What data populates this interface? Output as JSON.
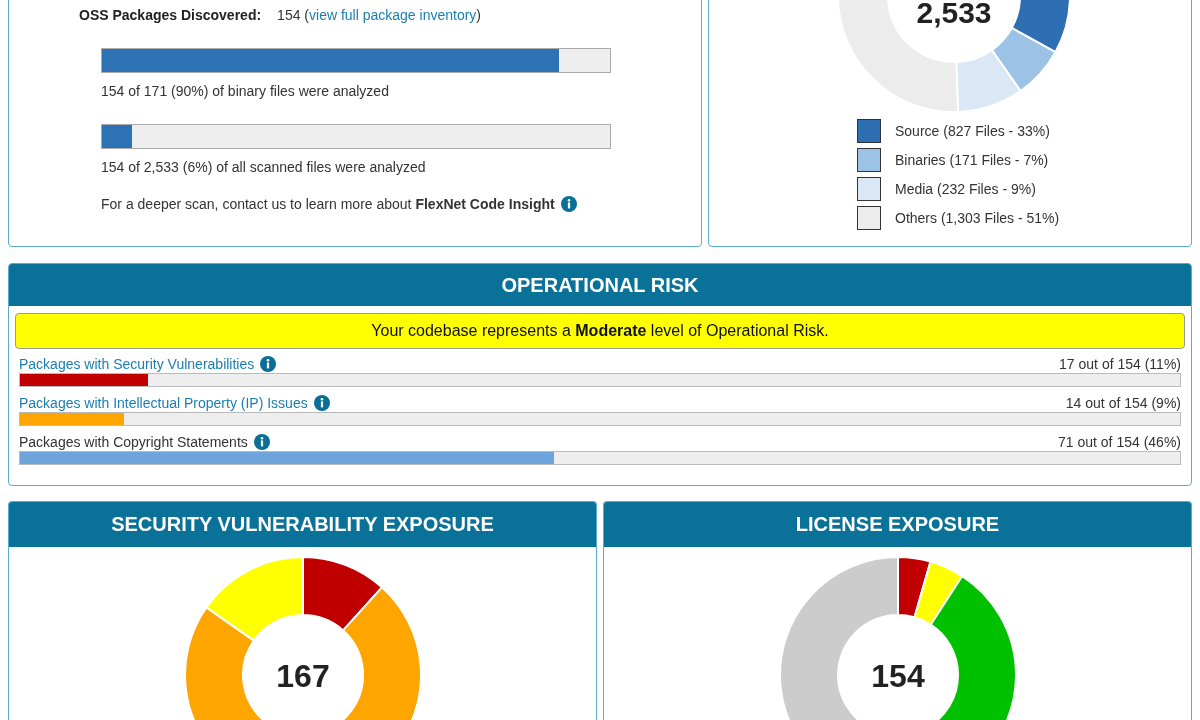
{
  "inventory": {
    "label": "OSS Packages Discovered:",
    "count": "154 (",
    "link": "view full package inventory",
    "count_suffix": ")",
    "bars": [
      {
        "level": 0.9,
        "caption": "154 of 171 (90%) of binary files were analyzed"
      },
      {
        "level": 0.06,
        "caption": "154 of 2,533 (6%) of all scanned files were analyzed"
      }
    ],
    "footer": "For a deeper scan, contact us to learn more about **FlexNet Code Insight**"
  },
  "file_types": {
    "total": "2,533",
    "legend": [
      {
        "label": "Source (827 Files - 33%)",
        "color": "#2e6fb3"
      },
      {
        "label": "Binaries (171 Files - 7%)",
        "color": "#9cc3e6"
      },
      {
        "label": "Media (232 Files - 9%)",
        "color": "#dae8f6"
      },
      {
        "label": "Others (1,303 Files - 51%)",
        "color": "#ececec"
      }
    ]
  },
  "operational_risk": {
    "title": "OPERATIONAL RISK",
    "banner": "Your codebase represents a **Moderate** level of Operational Risk.",
    "rows": [
      {
        "kind": "link",
        "label": "Packages with Security Vulnerabilities",
        "reading": "17 out of 154 (11%)",
        "level": 0.11,
        "color": "#c00000"
      },
      {
        "kind": "link",
        "label": "Packages with Intellectual Property (IP) Issues",
        "reading": "14 out of 154 (9%)",
        "level": 0.09,
        "color": "#ffa500"
      },
      {
        "kind": "plain",
        "label": "Packages with Copyright Statements",
        "reading": "71 out of 154 (46%)",
        "level": 0.46,
        "color": "#6ea4dc"
      }
    ]
  },
  "security_exposure": {
    "title": "SECURITY VULNERABILITY EXPOSURE",
    "total": "167"
  },
  "license_exposure": {
    "title": "LICENSE EXPOSURE",
    "total": "154"
  }
}
